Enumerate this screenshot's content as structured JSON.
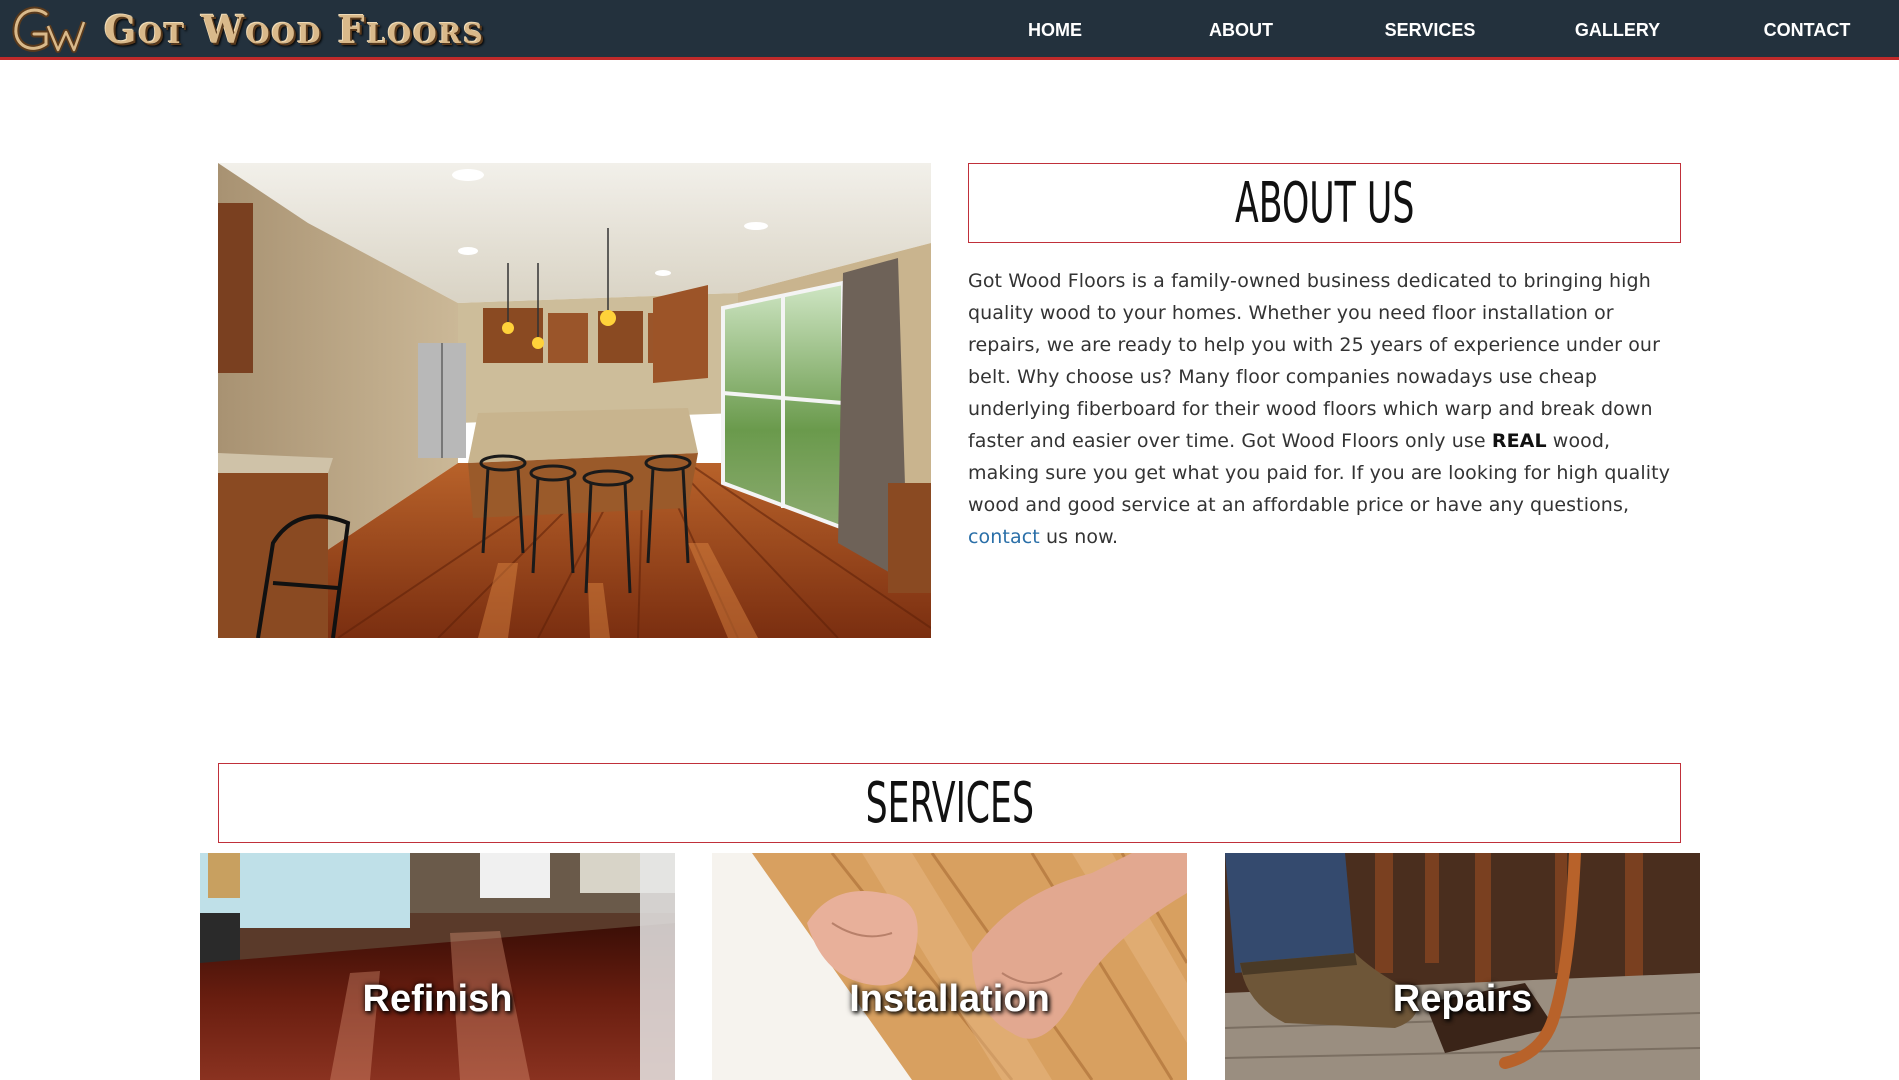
{
  "brand": {
    "monogram": "GW",
    "name": "Got Wood Floors"
  },
  "nav": {
    "items": [
      {
        "label": "HOME"
      },
      {
        "label": "ABOUT"
      },
      {
        "label": "SERVICES"
      },
      {
        "label": "GALLERY"
      },
      {
        "label": "CONTACT"
      }
    ]
  },
  "about": {
    "title": "ABOUT US",
    "text_1": "Got Wood Floors is a family-owned business dedicated to bringing high quality wood to your homes. Whether you need floor installation or repairs, we are ready to help you with 25 years of experience under our belt. Why choose us? Many floor companies nowadays use cheap underlying fiberboard for their wood floors which warp and break down faster and easier over time. Got Wood Floors only use ",
    "text_bold": "REAL",
    "text_2": " wood, making sure you get what you paid for. If you are looking for high quality wood and good service at an affordable price or have any questions, ",
    "link_label": "contact",
    "text_3": " us now."
  },
  "services": {
    "title": "SERVICES",
    "cards": [
      {
        "label": "Refinish"
      },
      {
        "label": "Installation"
      },
      {
        "label": "Repairs"
      }
    ]
  },
  "colors": {
    "navbar_bg": "#23313d",
    "accent_red": "#c0303a",
    "link_blue": "#2a6fa8"
  }
}
